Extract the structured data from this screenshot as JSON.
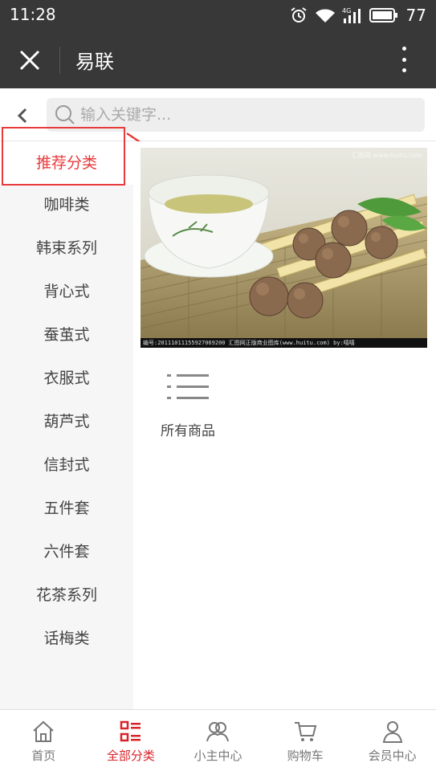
{
  "status_bar": {
    "time": "11:28",
    "network": "4G",
    "battery": "77",
    "icons": [
      "alarm-icon",
      "wifi-icon",
      "signal-icon",
      "battery-icon"
    ]
  },
  "header": {
    "title": "易联",
    "close_icon": "close-icon",
    "more_icon": "more-vertical-icon"
  },
  "search": {
    "placeholder": "输入关键字...",
    "back_icon": "chevron-left-icon",
    "search_icon": "search-icon"
  },
  "sidebar": {
    "active_index": 0,
    "items": [
      {
        "label": "推荐分类"
      },
      {
        "label": "咖啡类"
      },
      {
        "label": "韩束系列"
      },
      {
        "label": "背心式"
      },
      {
        "label": "蚕茧式"
      },
      {
        "label": "衣服式"
      },
      {
        "label": "葫芦式"
      },
      {
        "label": "信封式"
      },
      {
        "label": "五件套"
      },
      {
        "label": "六件套"
      },
      {
        "label": "花茶系列"
      },
      {
        "label": "话梅类"
      }
    ]
  },
  "main": {
    "banner": {
      "caption": "编号:20111011155927069200  汇图网正版商业图库(www.huitu.com)  by:嘻嘻",
      "watermark": "汇图网 www.huitu.com"
    },
    "all_goods": {
      "label": "所有商品",
      "icon": "list-icon"
    }
  },
  "bottom_nav": {
    "active_index": 1,
    "items": [
      {
        "label": "首页",
        "icon": "home-icon"
      },
      {
        "label": "全部分类",
        "icon": "category-icon"
      },
      {
        "label": "小主中心",
        "icon": "users-icon"
      },
      {
        "label": "购物车",
        "icon": "cart-icon"
      },
      {
        "label": "会员中心",
        "icon": "user-icon"
      }
    ]
  },
  "colors": {
    "accent": "#d9232b",
    "header_bg": "#383838",
    "sidebar_bg": "#f6f6f6",
    "annotation": "#e83a3a"
  }
}
